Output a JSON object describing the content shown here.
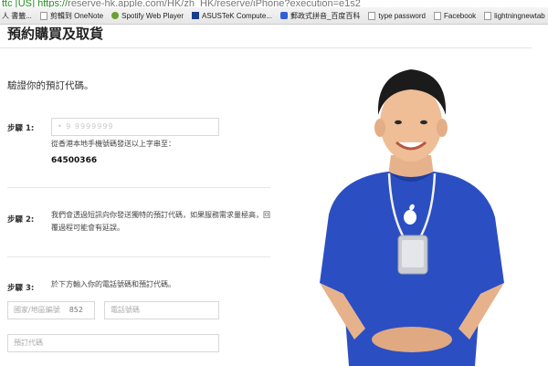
{
  "browser": {
    "url_lock": "ttc [US]",
    "url_scheme": "https://",
    "url_rest": "reserve-hk.apple.com/HK/zh_HK/reserve/iPhone?execution=e1s2",
    "bookmarks": [
      {
        "label": "人 書籤...",
        "icon": "page-icon"
      },
      {
        "label": "剪輯到 OneNote",
        "icon": "onenote-icon"
      },
      {
        "label": "Spotify Web Player",
        "icon": "spotify-icon"
      },
      {
        "label": "ASUSTeK Compute...",
        "icon": "asus-icon"
      },
      {
        "label": "郵政式拼音_百度百科",
        "icon": "baidu-icon"
      },
      {
        "label": "type password",
        "icon": "page-icon"
      },
      {
        "label": "Facebook",
        "icon": "page-icon"
      },
      {
        "label": "lightningnewtab",
        "icon": "page-icon"
      }
    ]
  },
  "page": {
    "title": "預約購買及取貨",
    "verify_heading": "驗證你的預訂代碼。",
    "step1": {
      "label": "步驟 1:",
      "field_value": "• 9 9999999",
      "help": "從香港本地手機號碼發送以上字串至：",
      "sms_number": "64500366"
    },
    "step2": {
      "label": "步驟 2:",
      "text": "我們會透過短訊向你發送獨特的預訂代碼，如果服務需求量極高，回覆過程可能會有延誤。"
    },
    "step3": {
      "label": "步驟 3:",
      "text": "於下方輸入你的電話號碼和預訂代碼。",
      "country_placeholder": "國家/地區編號",
      "country_value": "852",
      "phone_placeholder": "電話號碼",
      "code_placeholder": "預訂代碼"
    }
  },
  "colors": {
    "shirt": "#2b4fc2",
    "accent_green": "#2a8a2a"
  }
}
